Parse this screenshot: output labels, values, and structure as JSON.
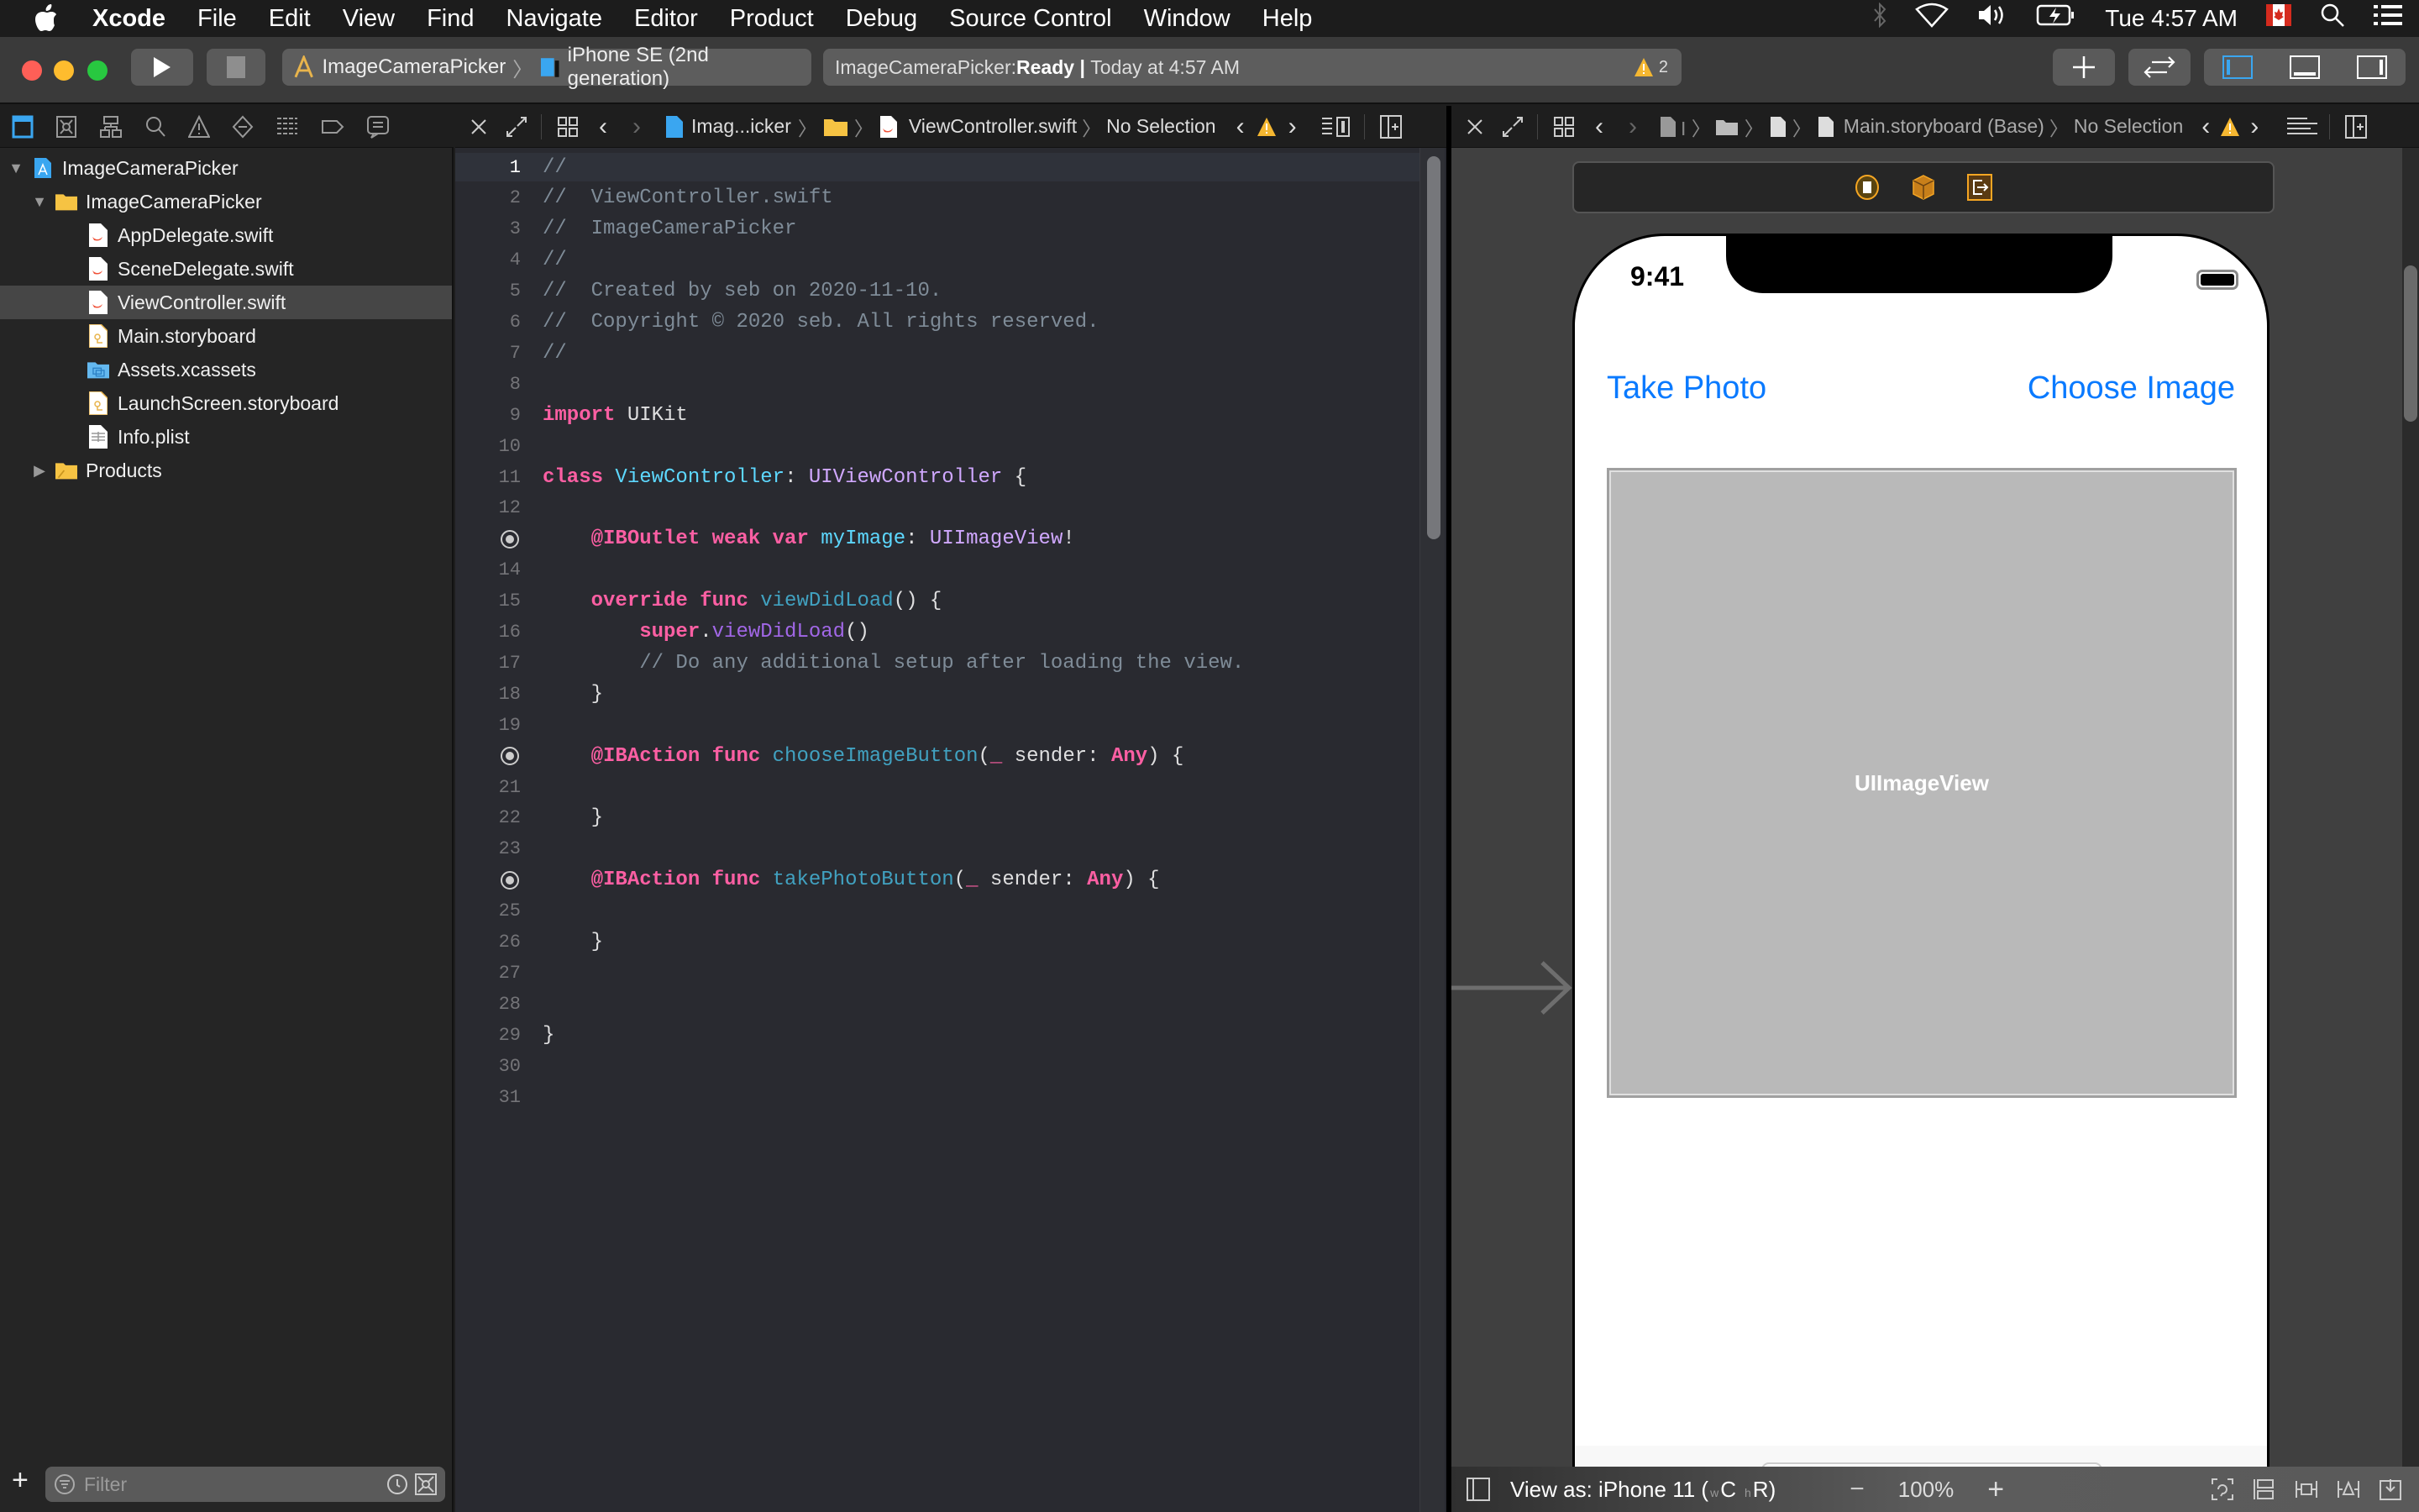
{
  "menubar": {
    "app": "Xcode",
    "items": [
      "File",
      "Edit",
      "View",
      "Find",
      "Navigate",
      "Editor",
      "Product",
      "Debug",
      "Source Control",
      "Window",
      "Help"
    ],
    "clock": "Tue 4:57 AM",
    "status_icons": [
      "bluetooth-icon",
      "wifi-icon",
      "volume-icon",
      "battery-charging-icon",
      "flag-canada-icon",
      "spotlight-search-icon",
      "notification-center-icon"
    ]
  },
  "toolbar": {
    "scheme": "ImageCameraPicker",
    "destination": "iPhone SE (2nd generation)",
    "activity_project": "ImageCameraPicker: ",
    "activity_status": "Ready",
    "activity_sep": " | ",
    "activity_time": "Today at 4:57 AM",
    "warning_count": "2",
    "colors": {
      "close": "#ff5f57",
      "minimize": "#febc2e",
      "zoom": "#28c840",
      "accent": "#3aa6f0"
    }
  },
  "navigator": {
    "tabs": [
      "project-navigator",
      "source-control-navigator",
      "symbol-navigator",
      "find-navigator",
      "issue-navigator",
      "test-navigator",
      "debug-navigator",
      "breakpoint-navigator",
      "report-navigator"
    ],
    "tree": [
      {
        "label": "ImageCameraPicker",
        "kind": "project",
        "level": 0,
        "expanded": true
      },
      {
        "label": "ImageCameraPicker",
        "kind": "folder",
        "level": 1,
        "expanded": true
      },
      {
        "label": "AppDelegate.swift",
        "kind": "swift",
        "level": 2
      },
      {
        "label": "SceneDelegate.swift",
        "kind": "swift",
        "level": 2
      },
      {
        "label": "ViewController.swift",
        "kind": "swift",
        "level": 2,
        "selected": true
      },
      {
        "label": "Main.storyboard",
        "kind": "storyboard",
        "level": 2
      },
      {
        "label": "Assets.xcassets",
        "kind": "assets",
        "level": 2
      },
      {
        "label": "LaunchScreen.storyboard",
        "kind": "storyboard",
        "level": 2
      },
      {
        "label": "Info.plist",
        "kind": "plist",
        "level": 2
      },
      {
        "label": "Products",
        "kind": "folder",
        "level": 1,
        "expanded": false
      }
    ],
    "filter_placeholder": "Filter"
  },
  "editor": {
    "jump_bar": {
      "project": "Imag...icker",
      "file": "ViewController.swift",
      "selection": "No Selection"
    },
    "current_line": 1,
    "lines": [
      [
        {
          "t": "//",
          "c": "cm"
        }
      ],
      [
        {
          "t": "//  ViewController.swift",
          "c": "cm"
        }
      ],
      [
        {
          "t": "//  ImageCameraPicker",
          "c": "cm"
        }
      ],
      [
        {
          "t": "//",
          "c": "cm"
        }
      ],
      [
        {
          "t": "//  Created by seb on 2020-11-10.",
          "c": "cm"
        }
      ],
      [
        {
          "t": "//  Copyright © 2020 seb. All rights reserved.",
          "c": "cm"
        }
      ],
      [
        {
          "t": "//",
          "c": "cm"
        }
      ],
      [],
      [
        {
          "t": "import",
          "c": "kw"
        },
        {
          "t": " UIKit",
          "c": "pl"
        }
      ],
      [],
      [
        {
          "t": "class",
          "c": "kw"
        },
        {
          "t": " ",
          "c": "pl"
        },
        {
          "t": "ViewController",
          "c": "tn"
        },
        {
          "t": ": ",
          "c": "pl"
        },
        {
          "t": "UIViewController",
          "c": "ty"
        },
        {
          "t": " {",
          "c": "pl"
        }
      ],
      [],
      [
        {
          "t": "    ",
          "c": "pl"
        },
        {
          "t": "@IBOutlet",
          "c": "kw"
        },
        {
          "t": " ",
          "c": "pl"
        },
        {
          "t": "weak",
          "c": "kw"
        },
        {
          "t": " ",
          "c": "pl"
        },
        {
          "t": "var",
          "c": "kw"
        },
        {
          "t": " ",
          "c": "pl"
        },
        {
          "t": "myImage",
          "c": "tn"
        },
        {
          "t": ": ",
          "c": "pl"
        },
        {
          "t": "UIImageView",
          "c": "ty"
        },
        {
          "t": "!",
          "c": "pl"
        }
      ],
      [],
      [
        {
          "t": "    ",
          "c": "pl"
        },
        {
          "t": "override",
          "c": "kw"
        },
        {
          "t": " ",
          "c": "pl"
        },
        {
          "t": "func",
          "c": "kw"
        },
        {
          "t": " ",
          "c": "pl"
        },
        {
          "t": "viewDidLoad",
          "c": "fn"
        },
        {
          "t": "() {",
          "c": "pl"
        }
      ],
      [
        {
          "t": "        ",
          "c": "pl"
        },
        {
          "t": "super",
          "c": "kw"
        },
        {
          "t": ".",
          "c": "pl"
        },
        {
          "t": "viewDidLoad",
          "c": "sf"
        },
        {
          "t": "()",
          "c": "pl"
        }
      ],
      [
        {
          "t": "        // Do any additional setup after loading the view.",
          "c": "cm"
        }
      ],
      [
        {
          "t": "    }",
          "c": "pl"
        }
      ],
      [],
      [
        {
          "t": "    ",
          "c": "pl"
        },
        {
          "t": "@IBAction",
          "c": "kw"
        },
        {
          "t": " ",
          "c": "pl"
        },
        {
          "t": "func",
          "c": "kw"
        },
        {
          "t": " ",
          "c": "pl"
        },
        {
          "t": "chooseImageButton",
          "c": "fn"
        },
        {
          "t": "(",
          "c": "pl"
        },
        {
          "t": "_",
          "c": "kw"
        },
        {
          "t": " sender: ",
          "c": "pl"
        },
        {
          "t": "Any",
          "c": "kw"
        },
        {
          "t": ") {",
          "c": "pl"
        }
      ],
      [],
      [
        {
          "t": "    }",
          "c": "pl"
        }
      ],
      [],
      [
        {
          "t": "    ",
          "c": "pl"
        },
        {
          "t": "@IBAction",
          "c": "kw"
        },
        {
          "t": " ",
          "c": "pl"
        },
        {
          "t": "func",
          "c": "kw"
        },
        {
          "t": " ",
          "c": "pl"
        },
        {
          "t": "takePhotoButton",
          "c": "fn"
        },
        {
          "t": "(",
          "c": "pl"
        },
        {
          "t": "_",
          "c": "kw"
        },
        {
          "t": " sender: ",
          "c": "pl"
        },
        {
          "t": "Any",
          "c": "kw"
        },
        {
          "t": ") {",
          "c": "pl"
        }
      ],
      [],
      [
        {
          "t": "    }",
          "c": "pl"
        }
      ],
      [],
      [],
      [
        {
          "t": "}",
          "c": "pl"
        }
      ],
      [],
      []
    ],
    "connection_lines": [
      13,
      20,
      24
    ]
  },
  "interface_builder": {
    "jump_bar": {
      "file": "Main.storyboard (Base)",
      "selection": "No Selection"
    },
    "device_status_time": "9:41",
    "take_photo_label": "Take Photo",
    "choose_image_label": "Choose Image",
    "image_view_label": "UIImageView",
    "bottom_bar": {
      "view_as_prefix": "View as: iPhone 11 (",
      "size_class_w": "w",
      "size_class_w_val": "C",
      "size_class_h": "h",
      "size_class_h_val": "R",
      "view_as_suffix": ")",
      "zoom": "100%"
    },
    "tint_color": "#0a7aff"
  }
}
